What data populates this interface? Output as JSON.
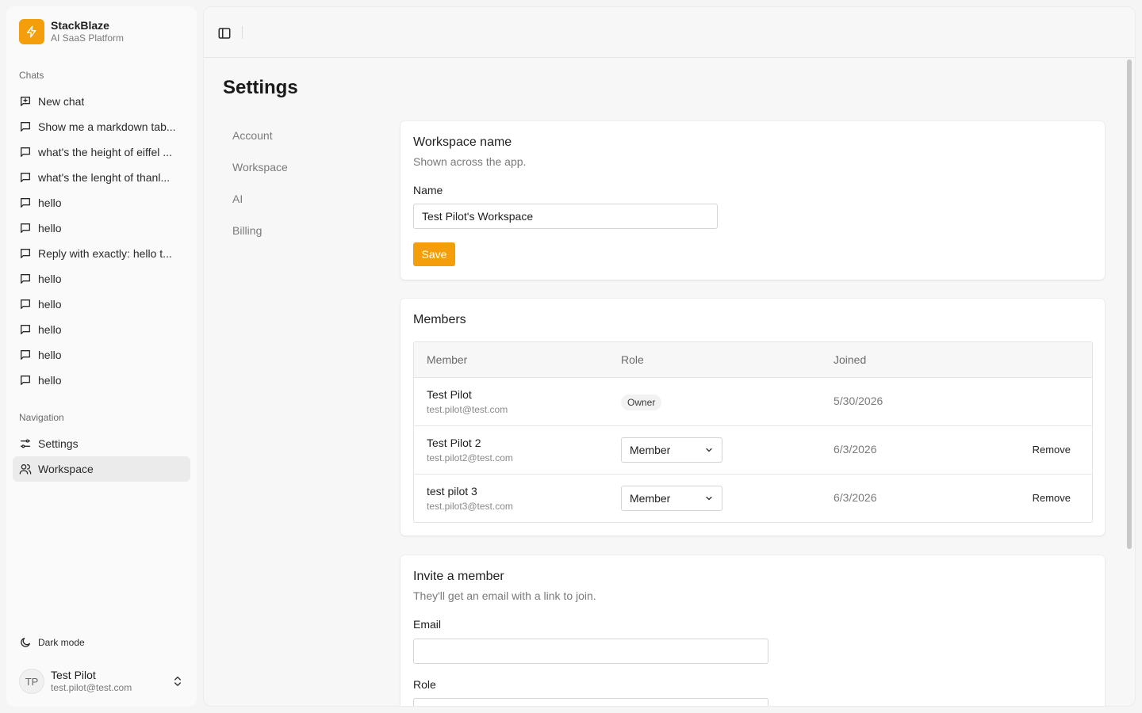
{
  "brand": {
    "name": "StackBlaze",
    "subtitle": "AI SaaS Platform",
    "color": "#f59e0b"
  },
  "sidebar": {
    "chats_label": "Chats",
    "chats": [
      {
        "label": "New chat",
        "icon": "message-plus-icon"
      },
      {
        "label": "Show me a markdown tab...",
        "icon": "message-icon"
      },
      {
        "label": "what's the height of eiffel ...",
        "icon": "message-icon"
      },
      {
        "label": "what's the lenght of thanl...",
        "icon": "message-icon"
      },
      {
        "label": "hello",
        "icon": "message-icon"
      },
      {
        "label": "hello",
        "icon": "message-icon"
      },
      {
        "label": "Reply with exactly: hello t...",
        "icon": "message-icon"
      },
      {
        "label": "hello",
        "icon": "message-icon"
      },
      {
        "label": "hello",
        "icon": "message-icon"
      },
      {
        "label": "hello",
        "icon": "message-icon"
      },
      {
        "label": "hello",
        "icon": "message-icon"
      },
      {
        "label": "hello",
        "icon": "message-icon"
      }
    ],
    "navigation_label": "Navigation",
    "navigation": [
      {
        "label": "Settings",
        "icon": "sliders-icon"
      },
      {
        "label": "Workspace",
        "icon": "users-icon",
        "active": true
      }
    ],
    "dark_mode_label": "Dark mode",
    "user": {
      "initials": "TP",
      "name": "Test Pilot",
      "email": "test.pilot@test.com"
    }
  },
  "page": {
    "title": "Settings"
  },
  "settings_nav": [
    "Account",
    "Workspace",
    "AI",
    "Billing"
  ],
  "workspace_card": {
    "title": "Workspace name",
    "description": "Shown across the app.",
    "name_label": "Name",
    "name_value": "Test Pilot's Workspace",
    "save_label": "Save"
  },
  "members_card": {
    "title": "Members",
    "columns": [
      "Member",
      "Role",
      "Joined"
    ],
    "rows": [
      {
        "name": "Test Pilot",
        "email": "test.pilot@test.com",
        "role": "Owner",
        "joined": "5/30/2026"
      },
      {
        "name": "Test Pilot 2",
        "email": "test.pilot2@test.com",
        "role": "Member",
        "joined": "6/3/2026",
        "action": "Remove"
      },
      {
        "name": "test pilot 3",
        "email": "test.pilot3@test.com",
        "role": "Member",
        "joined": "6/3/2026",
        "action": "Remove"
      }
    ]
  },
  "invite_card": {
    "title": "Invite a member",
    "description": "They'll get an email with a link to join.",
    "email_label": "Email",
    "email_value": "",
    "role_label": "Role"
  }
}
